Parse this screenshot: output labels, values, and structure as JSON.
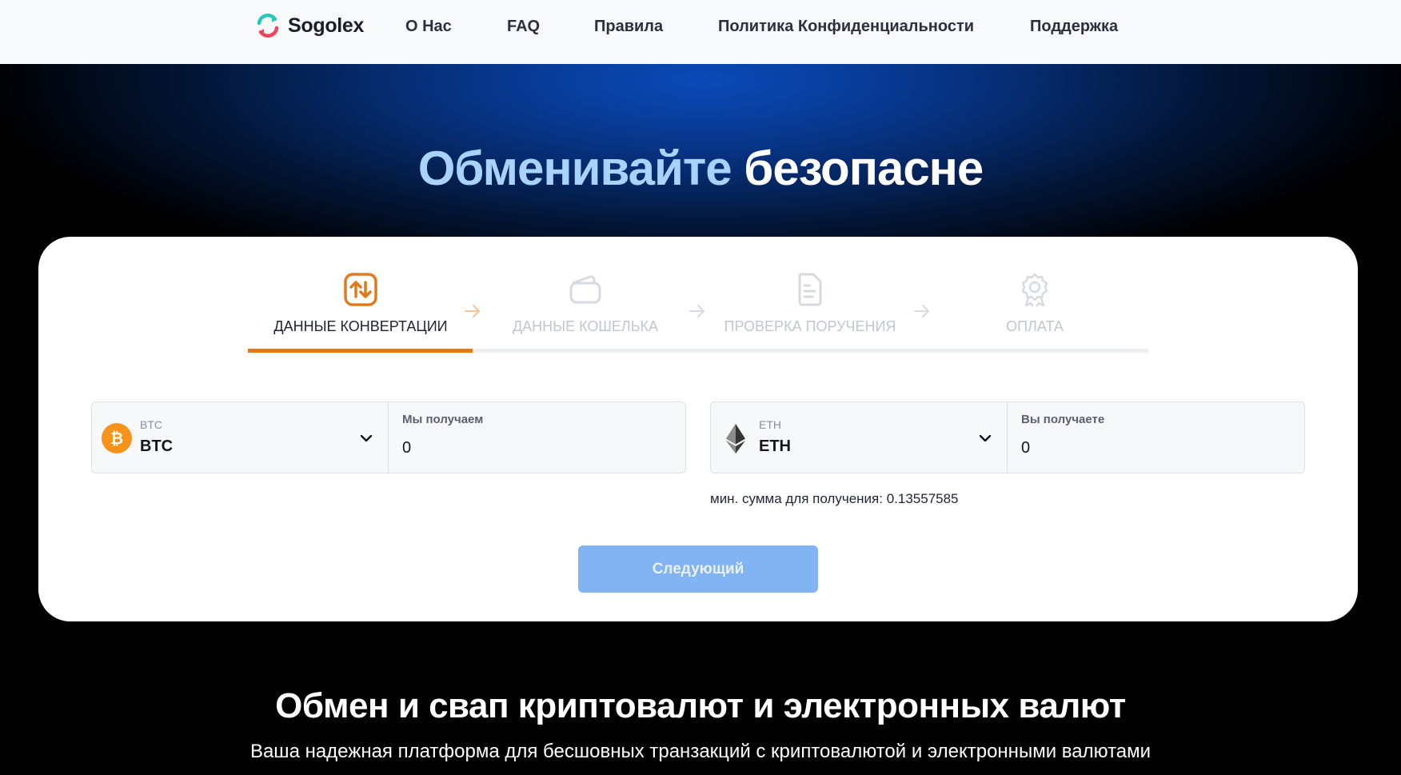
{
  "brand": {
    "name": "Sogolex"
  },
  "nav": [
    {
      "label": "О Нас"
    },
    {
      "label": "FAQ"
    },
    {
      "label": "Правила"
    },
    {
      "label": "Политика Конфиденциальности"
    },
    {
      "label": "Поддержка"
    }
  ],
  "hero": {
    "title_accent": "Обменивайте",
    "title_main": "безопасне"
  },
  "steps": [
    {
      "label": "ДАННЫЕ КОНВЕРТАЦИИ",
      "icon": "swap-vertical-icon",
      "active": true
    },
    {
      "label": "ДАННЫЕ КОШЕЛЬКА",
      "icon": "wallet-icon",
      "active": false
    },
    {
      "label": "ПРОВЕРКА ПОРУЧЕНИЯ",
      "icon": "document-icon",
      "active": false
    },
    {
      "label": "ОПЛАТА",
      "icon": "award-icon",
      "active": false
    }
  ],
  "from": {
    "currency_code": "BTC",
    "currency_name": "BTC",
    "field_label": "Мы получаем",
    "amount": "0",
    "icon": "bitcoin-icon"
  },
  "to": {
    "currency_code": "ETH",
    "currency_name": "ETH",
    "field_label": "Вы получаете",
    "amount": "0",
    "icon": "ethereum-icon"
  },
  "min_sum_text": "мин. сумма для получения: 0.13557585",
  "next_button": "Следующий",
  "section": {
    "title": "Обмен и свап криптовалют и электронных валют",
    "subtitle": "Ваша надежная платформа для бесшовных транзакций с криптовалютой и электронными валютами"
  },
  "colors": {
    "accent": "#e07b1c",
    "primary_button": "#82b3f3",
    "hero_accent": "#a9d3ff"
  }
}
